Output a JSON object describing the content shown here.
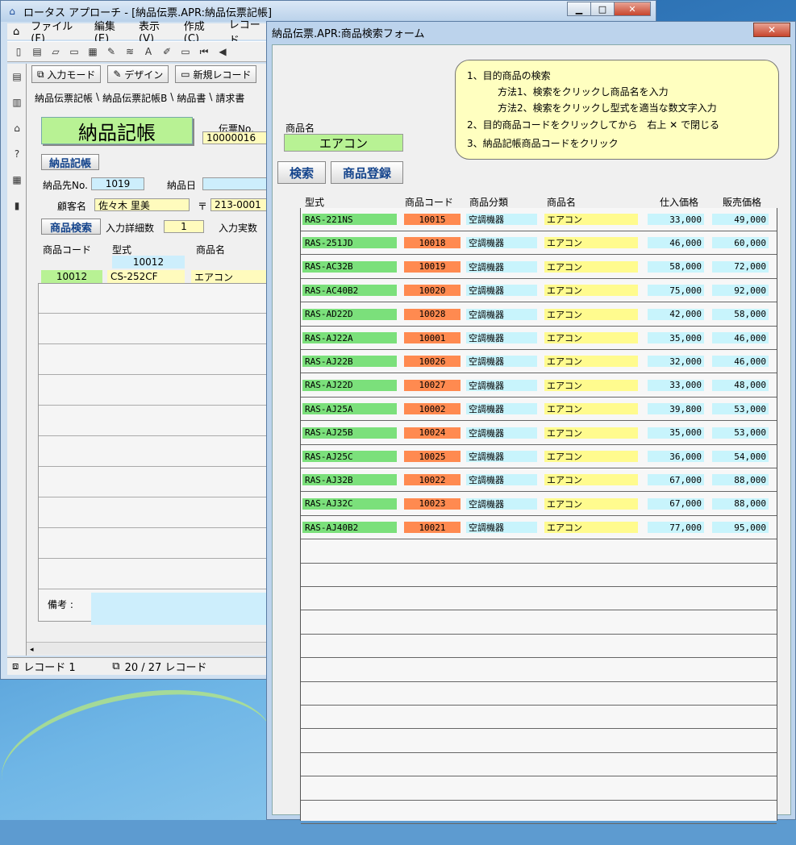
{
  "main_window": {
    "title": "ロータス アプローチ - [納品伝票.APR:納品伝票記帳]",
    "menu": [
      "ファイル(F)",
      "編集(E)",
      "表示(V)",
      "作成(C)",
      "レコード"
    ],
    "mode_buttons": {
      "input_mode": "入力モード",
      "design": "デザイン",
      "new_record": "新規レコード"
    },
    "tabs": [
      "納品伝票記帳",
      "納品伝票記帳B",
      "納品書",
      "請求書"
    ],
    "form": {
      "title": "納品記帳",
      "slip_no_label": "伝票No.",
      "slip_no": "10000016",
      "record_button": "納品記帳",
      "dest_no_label": "納品先No.",
      "dest_no": "1019",
      "delivery_date_label": "納品日",
      "customer_label": "顧客名",
      "customer": "佐々木 里美",
      "zip_mark": "〒",
      "zip": "213-0001",
      "search_button": "商品検索",
      "detail_count_label": "入力詳細数",
      "detail_count": "1",
      "actual_count_label": "入力実数",
      "col_code": "商品コード",
      "col_model": "型式",
      "col_name": "商品名",
      "top_code": "10012",
      "line_code": "10012",
      "line_model": "CS-252CF",
      "line_name": "エアコン",
      "remarks_label": "備考 :"
    },
    "status": {
      "record": "レコード 1",
      "count": "20 / 27 レコード"
    }
  },
  "dialog": {
    "title": "納品伝票.APR:商品検索フォーム",
    "close": "✕",
    "product_name_label": "商品名",
    "product_name_value": "エアコン",
    "search_button": "検索",
    "register_button": "商品登録",
    "instructions": {
      "l1": "1、目的商品の検索",
      "l2": "方法1、検索をクリックし商品名を入力",
      "l3": "方法2、検索をクリックし型式を適当な数文字入力",
      "l4a": "2、目的商品コードをクリックしてから　右上",
      "l4x": "✕",
      "l4b": "で閉じる",
      "l5": "3、納品記帳商品コードをクリック"
    },
    "headers": {
      "model": "型式",
      "code": "商品コード",
      "category": "商品分類",
      "name": "商品名",
      "cost": "仕入価格",
      "price": "販売価格"
    },
    "rows": [
      {
        "model": "RAS-221NS",
        "code": "10015",
        "category": "空調機器",
        "name": "エアコン",
        "cost": "33,000",
        "price": "49,000"
      },
      {
        "model": "RAS-251JD",
        "code": "10018",
        "category": "空調機器",
        "name": "エアコン",
        "cost": "46,000",
        "price": "60,000"
      },
      {
        "model": "RAS-AC32B",
        "code": "10019",
        "category": "空調機器",
        "name": "エアコン",
        "cost": "58,000",
        "price": "72,000"
      },
      {
        "model": "RAS-AC40B2",
        "code": "10020",
        "category": "空調機器",
        "name": "エアコン",
        "cost": "75,000",
        "price": "92,000"
      },
      {
        "model": "RAS-AD22D",
        "code": "10028",
        "category": "空調機器",
        "name": "エアコン",
        "cost": "42,000",
        "price": "58,000"
      },
      {
        "model": "RAS-AJ22A",
        "code": "10001",
        "category": "空調機器",
        "name": "エアコン",
        "cost": "35,000",
        "price": "46,000"
      },
      {
        "model": "RAS-AJ22B",
        "code": "10026",
        "category": "空調機器",
        "name": "エアコン",
        "cost": "32,000",
        "price": "46,000"
      },
      {
        "model": "RAS-AJ22D",
        "code": "10027",
        "category": "空調機器",
        "name": "エアコン",
        "cost": "33,000",
        "price": "48,000"
      },
      {
        "model": "RAS-AJ25A",
        "code": "10002",
        "category": "空調機器",
        "name": "エアコン",
        "cost": "39,800",
        "price": "53,000"
      },
      {
        "model": "RAS-AJ25B",
        "code": "10024",
        "category": "空調機器",
        "name": "エアコン",
        "cost": "35,000",
        "price": "53,000"
      },
      {
        "model": "RAS-AJ25C",
        "code": "10025",
        "category": "空調機器",
        "name": "エアコン",
        "cost": "36,000",
        "price": "54,000"
      },
      {
        "model": "RAS-AJ32B",
        "code": "10022",
        "category": "空調機器",
        "name": "エアコン",
        "cost": "67,000",
        "price": "88,000"
      },
      {
        "model": "RAS-AJ32C",
        "code": "10023",
        "category": "空調機器",
        "name": "エアコン",
        "cost": "67,000",
        "price": "88,000"
      },
      {
        "model": "RAS-AJ40B2",
        "code": "10021",
        "category": "空調機器",
        "name": "エアコン",
        "cost": "77,000",
        "price": "95,000"
      }
    ]
  }
}
